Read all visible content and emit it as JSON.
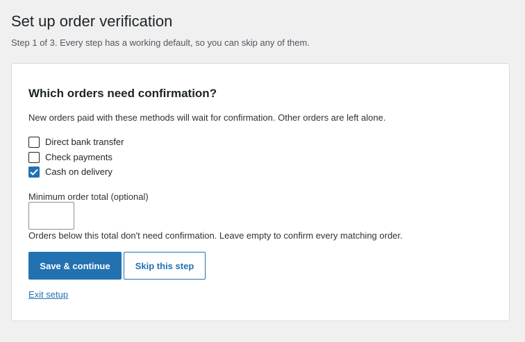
{
  "header": {
    "title": "Set up order verification",
    "subtitle": "Step 1 of 3. Every step has a working default, so you can skip any of them."
  },
  "card": {
    "heading": "Which orders need confirmation?",
    "description": "New orders paid with these methods will wait for confirmation. Other orders are left alone.",
    "methods": [
      {
        "label": "Direct bank transfer",
        "checked": false
      },
      {
        "label": "Check payments",
        "checked": false
      },
      {
        "label": "Cash on delivery",
        "checked": true
      }
    ],
    "minimum_total": {
      "label": "Minimum order total (optional)",
      "value": "",
      "help": "Orders below this total don't need confirmation. Leave empty to confirm every matching order."
    },
    "actions": {
      "save_label": "Save & continue",
      "skip_label": "Skip this step",
      "exit_label": "Exit setup"
    }
  },
  "colors": {
    "accent": "#2271b1",
    "background": "#f0f0f1",
    "card": "#ffffff",
    "text": "#1d2327"
  },
  "icons": {
    "checked_mark": "check-icon"
  }
}
